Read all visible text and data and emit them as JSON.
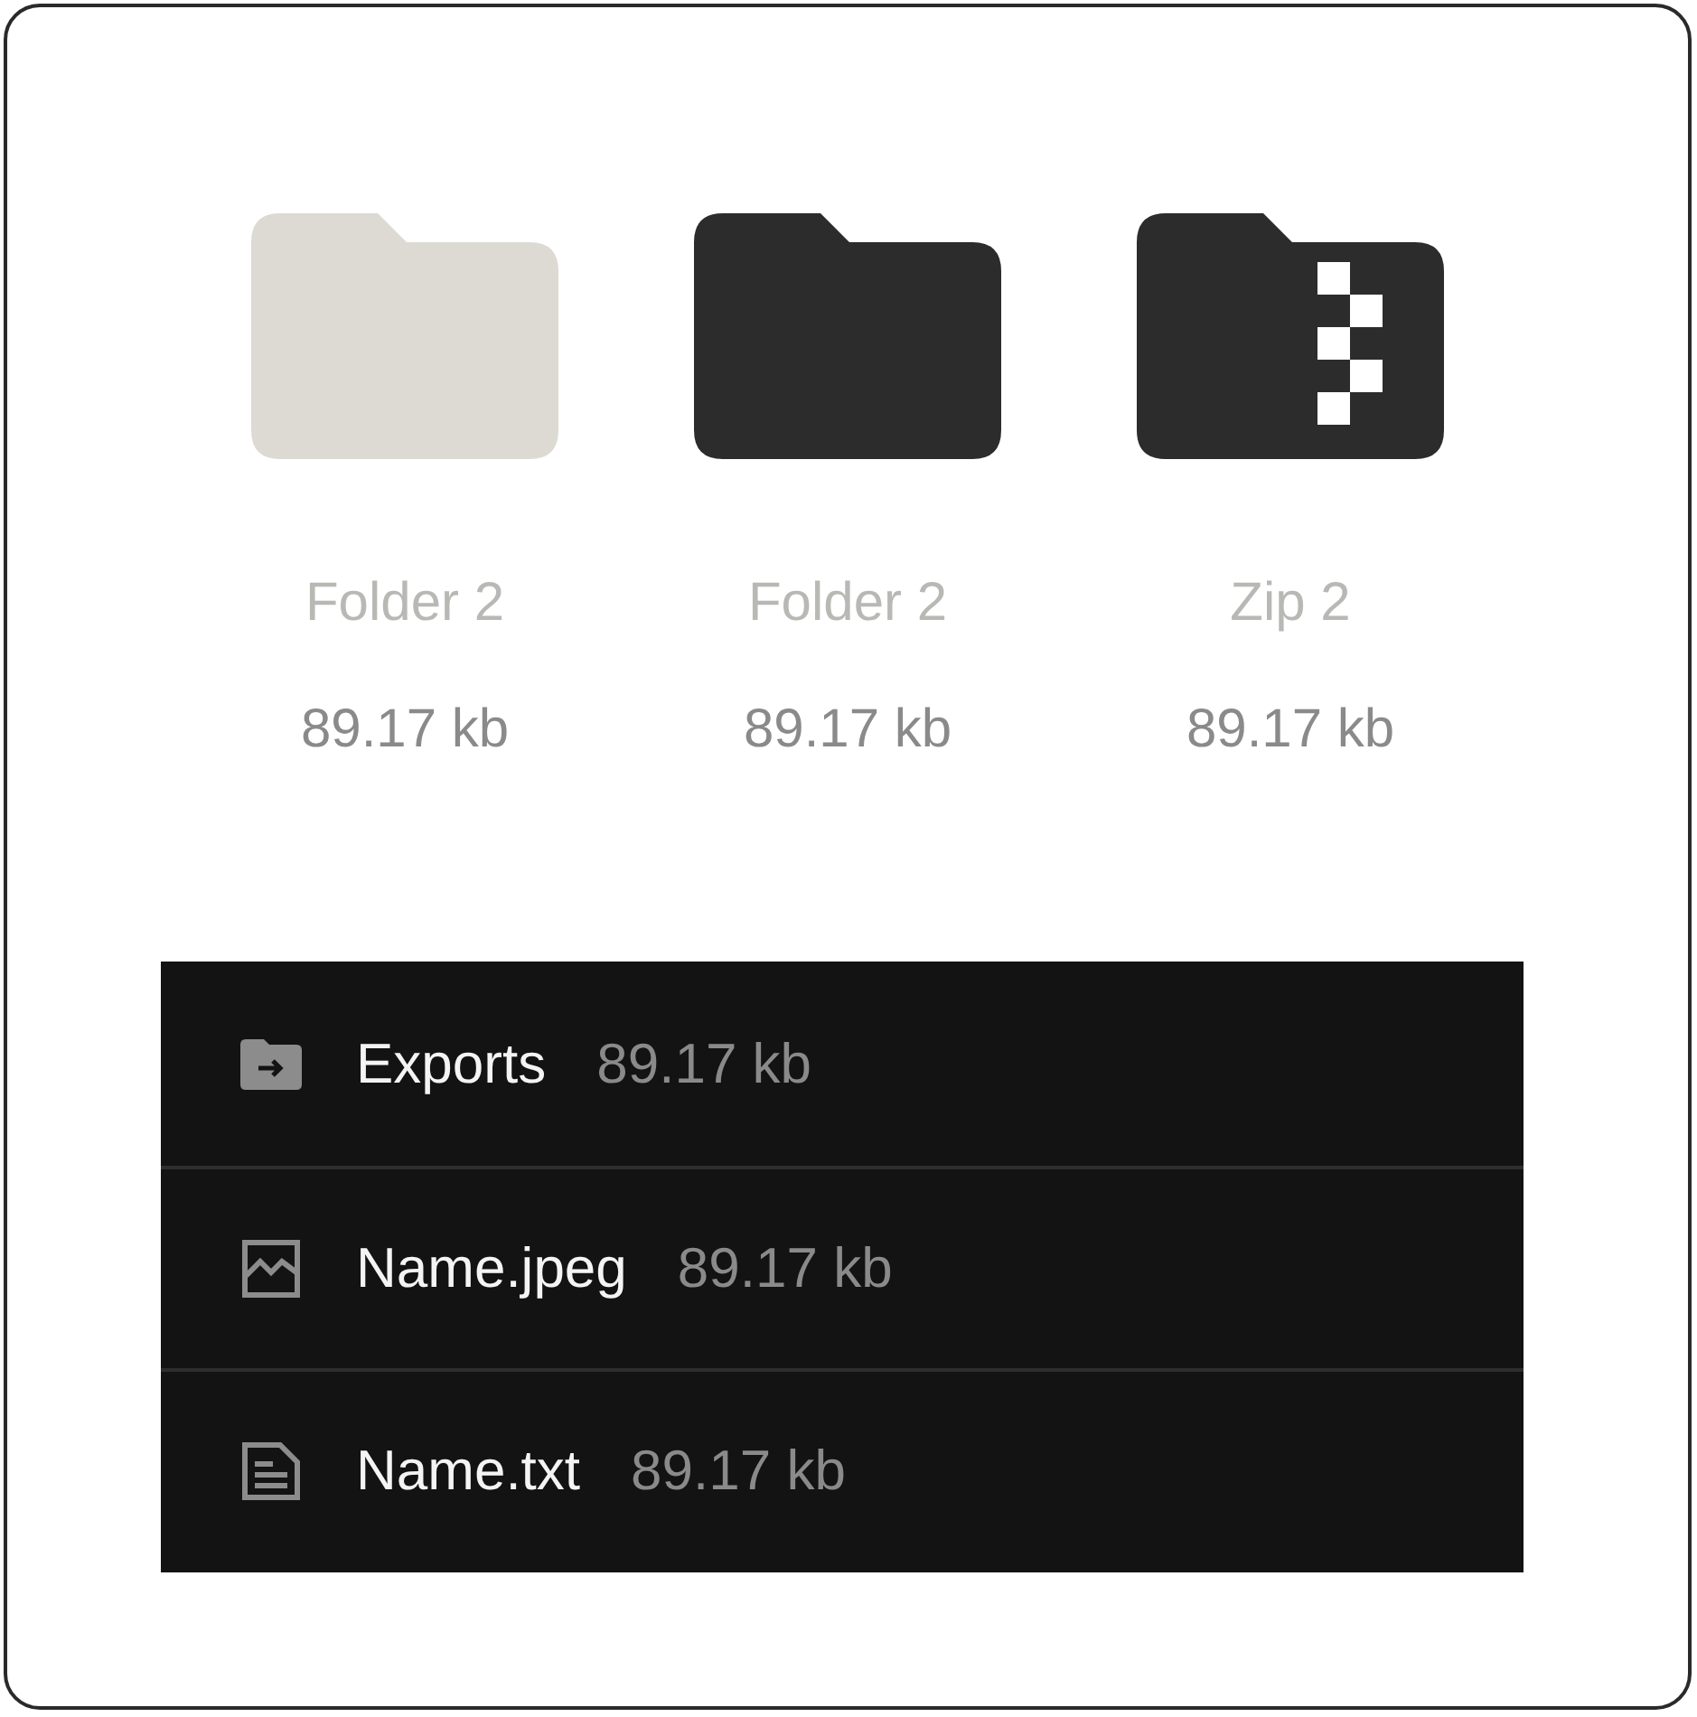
{
  "grid_items": [
    {
      "kind": "folder",
      "color": "#dcdad3",
      "name": "Folder 2",
      "size": "89.17 kb"
    },
    {
      "kind": "folder",
      "color": "#2c2c2c",
      "name": "Folder 2",
      "size": "89.17 kb"
    },
    {
      "kind": "zip",
      "color": "#2c2c2c",
      "name": "Zip 2",
      "size": "89.17 kb"
    }
  ],
  "list_items": [
    {
      "kind": "export",
      "name": "Exports",
      "size": "89.17 kb"
    },
    {
      "kind": "image",
      "name": "Name.jpeg",
      "size": "89.17 kb"
    },
    {
      "kind": "text",
      "name": "Name.txt",
      "size": "89.17 kb"
    }
  ]
}
